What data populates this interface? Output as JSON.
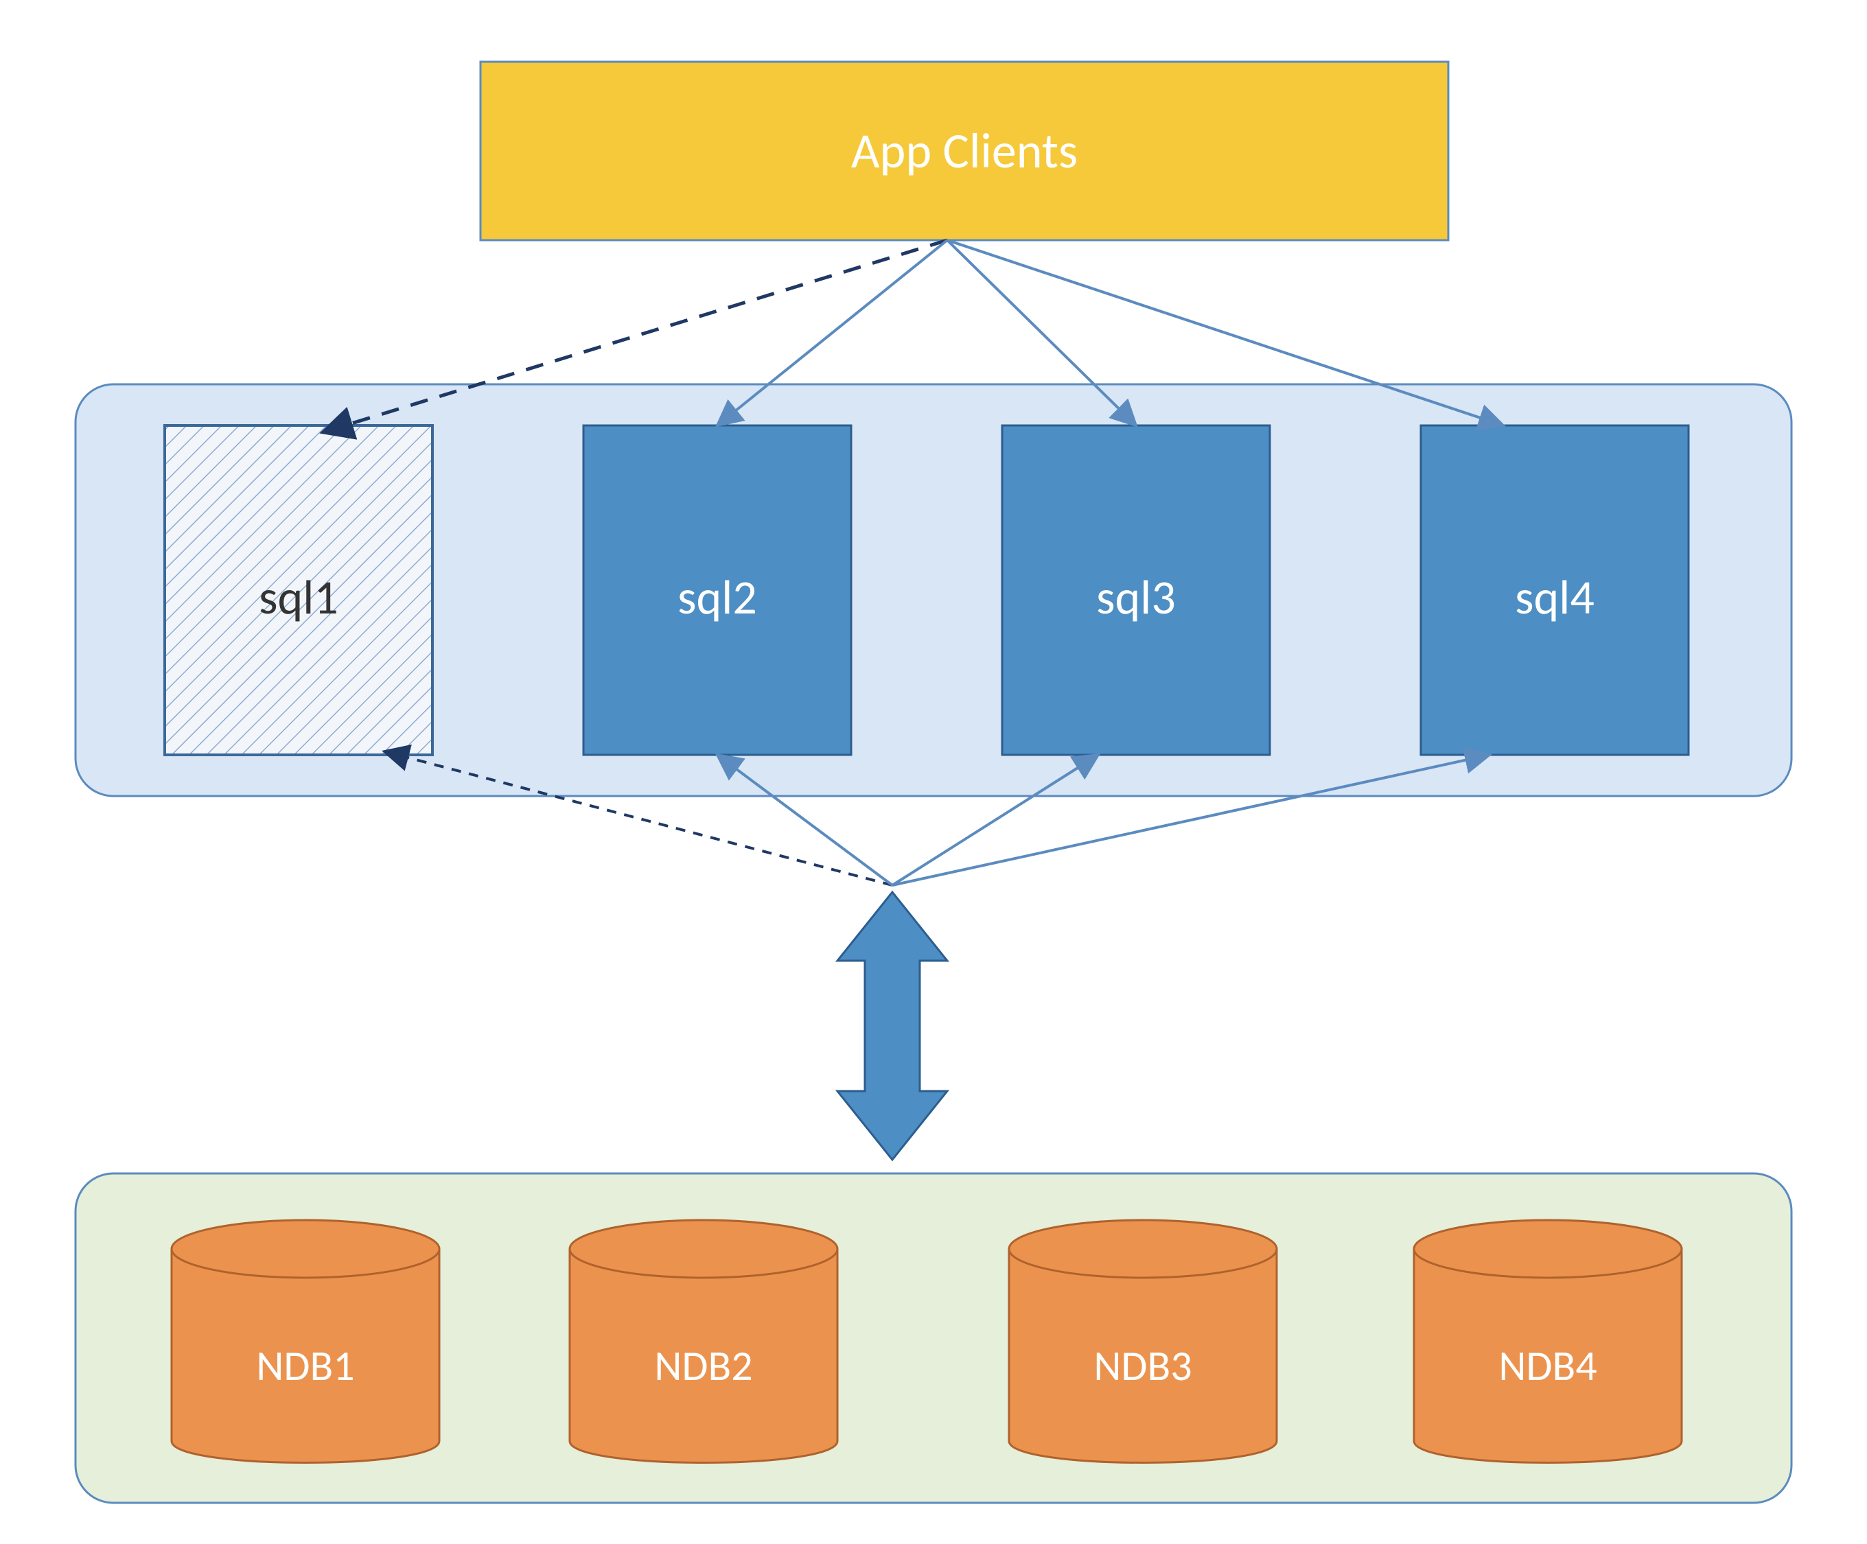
{
  "colors": {
    "yellow_fill": "#f6c93a",
    "yellow_stroke": "#5b8bbf",
    "sql_container_fill": "#d8e6f5",
    "sql_container_stroke": "#5b8bbf",
    "sql_box_fill": "#4d8ec4",
    "sql_box_stroke": "#2c5d8f",
    "sql1_hatch_fill": "#f2f6fb",
    "sql1_stroke": "#3b6899",
    "ndb_container_fill": "#e5efda",
    "ndb_container_stroke": "#5b8bbf",
    "cylinder_fill": "#eb934e",
    "cylinder_stroke": "#b0622d",
    "arrow_solid": "#5b8bbf",
    "arrow_dark_dash": "#1f3864",
    "bidir_fill": "#4d8ec4",
    "bidir_stroke": "#2c5d8f",
    "text_white": "#ffffff",
    "text_dark": "#333333"
  },
  "app_clients": {
    "label": "App Clients"
  },
  "sql_nodes": [
    {
      "id": "sql1",
      "label": "sql1",
      "dashed": true,
      "text_color": "dark"
    },
    {
      "id": "sql2",
      "label": "sql2",
      "dashed": false,
      "text_color": "white"
    },
    {
      "id": "sql3",
      "label": "sql3",
      "dashed": false,
      "text_color": "white"
    },
    {
      "id": "sql4",
      "label": "sql4",
      "dashed": false,
      "text_color": "white"
    }
  ],
  "ndb_nodes": [
    {
      "id": "ndb1",
      "label": "NDB1"
    },
    {
      "id": "ndb2",
      "label": "NDB2"
    },
    {
      "id": "ndb3",
      "label": "NDB3"
    },
    {
      "id": "ndb4",
      "label": "NDB4"
    }
  ]
}
